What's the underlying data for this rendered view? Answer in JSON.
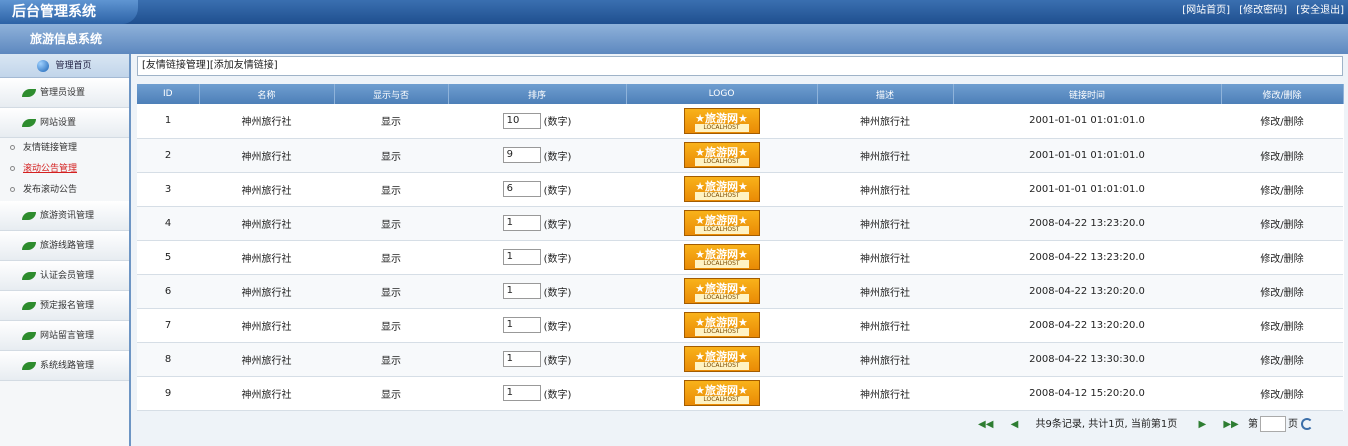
{
  "app": {
    "logo_text": "后台管理系统",
    "system_title": "旅游信息系统"
  },
  "top_links": [
    "[网站首页]",
    "[修改密码]",
    "[安全退出]"
  ],
  "sidebar": {
    "home_label": "管理首页",
    "groups_before": [
      {
        "label": "管理员设置"
      },
      {
        "label": "网站设置"
      }
    ],
    "sub_items": [
      {
        "label": "友情链接管理",
        "active": false
      },
      {
        "label": "滚动公告管理",
        "active": true
      },
      {
        "label": "发布滚动公告",
        "active": false
      }
    ],
    "groups_after": [
      {
        "label": "旅游资讯管理"
      },
      {
        "label": "旅游线路管理"
      },
      {
        "label": "认证会员管理"
      },
      {
        "label": "预定报名管理"
      },
      {
        "label": "网站留言管理"
      },
      {
        "label": "系统线路管理"
      }
    ]
  },
  "breadcrumb": {
    "manage_link": "[友情链接管理]",
    "add_link": "[添加友情链接]"
  },
  "table": {
    "columns": [
      "ID",
      "名称",
      "显示与否",
      "排序",
      "LOGO",
      "描述",
      "链接时间",
      "修改/删除"
    ],
    "sort_note": "(数字)",
    "logo": {
      "cn": "★旅游网★",
      "en": "LOCALHOST"
    },
    "rows": [
      {
        "id": "1",
        "name": "神州旅行社",
        "show": "显示",
        "sort": "10",
        "desc": "神州旅行社",
        "time": "2001-01-01 01:01:01.0",
        "ops": "修改/删除"
      },
      {
        "id": "2",
        "name": "神州旅行社",
        "show": "显示",
        "sort": "9",
        "desc": "神州旅行社",
        "time": "2001-01-01 01:01:01.0",
        "ops": "修改/删除"
      },
      {
        "id": "3",
        "name": "神州旅行社",
        "show": "显示",
        "sort": "6",
        "desc": "神州旅行社",
        "time": "2001-01-01 01:01:01.0",
        "ops": "修改/删除"
      },
      {
        "id": "4",
        "name": "神州旅行社",
        "show": "显示",
        "sort": "1",
        "desc": "神州旅行社",
        "time": "2008-04-22 13:23:20.0",
        "ops": "修改/删除"
      },
      {
        "id": "5",
        "name": "神州旅行社",
        "show": "显示",
        "sort": "1",
        "desc": "神州旅行社",
        "time": "2008-04-22 13:23:20.0",
        "ops": "修改/删除"
      },
      {
        "id": "6",
        "name": "神州旅行社",
        "show": "显示",
        "sort": "1",
        "desc": "神州旅行社",
        "time": "2008-04-22 13:20:20.0",
        "ops": "修改/删除"
      },
      {
        "id": "7",
        "name": "神州旅行社",
        "show": "显示",
        "sort": "1",
        "desc": "神州旅行社",
        "time": "2008-04-22 13:20:20.0",
        "ops": "修改/删除"
      },
      {
        "id": "8",
        "name": "神州旅行社",
        "show": "显示",
        "sort": "1",
        "desc": "神州旅行社",
        "time": "2008-04-22 13:30:30.0",
        "ops": "修改/删除"
      },
      {
        "id": "9",
        "name": "神州旅行社",
        "show": "显示",
        "sort": "1",
        "desc": "神州旅行社",
        "time": "2008-04-12 15:20:20.0",
        "ops": "修改/删除"
      }
    ]
  },
  "pager": {
    "first_icon": "first-page-icon",
    "prev_icon": "prev-page-icon",
    "summary": "共9条记录, 共计1页, 当前第1页",
    "next_icon": "next-page-icon",
    "last_icon": "last-page-icon",
    "page_prefix": "第",
    "page_suffix": "页",
    "go_icon": "go-icon"
  },
  "colors": {
    "header_blue": "#1f4f8f",
    "table_header": "#5b8cc4",
    "active_link": "#d42020",
    "logo_orange": "#f29a0c"
  }
}
